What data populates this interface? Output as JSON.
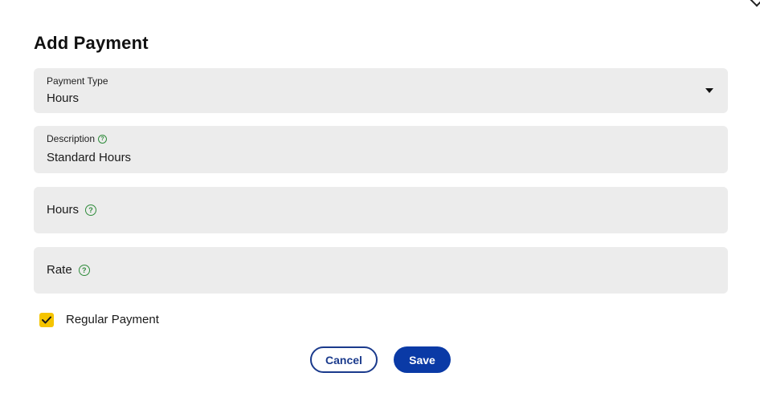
{
  "dialog": {
    "title": "Add Payment"
  },
  "fields": {
    "payment_type": {
      "label": "Payment Type",
      "value": "Hours"
    },
    "description": {
      "label": "Description",
      "value": "Standard Hours"
    },
    "hours": {
      "placeholder": "Hours"
    },
    "rate": {
      "placeholder": "Rate"
    }
  },
  "regular_payment": {
    "label": "Regular Payment",
    "checked": true
  },
  "actions": {
    "cancel_label": "Cancel",
    "save_label": "Save"
  },
  "colors": {
    "accent": "#0a3aa6",
    "checkbox": "#f5c400",
    "help_icon": "#2e8b3a",
    "field_bg": "#ececec"
  }
}
